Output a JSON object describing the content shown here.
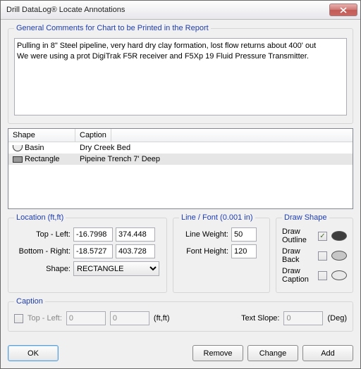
{
  "window": {
    "title": "Drill DataLog® Locate Annotations"
  },
  "comments": {
    "legend": "General Comments for Chart to be Printed in the Report",
    "text": "Pulling in 8\" Steel pipeline, very hard dry clay formation, lost flow returns about 400' out\nWe were using a prot DigiTrak F5R receiver and F5Xp 19 Fluid Pressure Transmitter."
  },
  "table": {
    "head_shape": "Shape",
    "head_caption": "Caption",
    "rows": [
      {
        "shape": "Basin",
        "caption": "Dry Creek Bed"
      },
      {
        "shape": "Rectangle",
        "caption": "Pipeine Trench 7' Deep"
      }
    ]
  },
  "location": {
    "legend": "Location (ft,ft)",
    "top_left_label": "Top - Left:",
    "bottom_right_label": "Bottom - Right:",
    "shape_label": "Shape:",
    "tl_x": "-16.7998",
    "tl_y": "374.448",
    "br_x": "-18.5727",
    "br_y": "403.728",
    "shape_value": "RECTANGLE"
  },
  "linefont": {
    "legend": "Line / Font (0.001 in)",
    "lw_label": "Line Weight:",
    "fh_label": "Font Height:",
    "lw": "50",
    "fh": "120"
  },
  "draw": {
    "legend": "Draw Shape",
    "outline_label": "Draw Outline",
    "back_label": "Draw Back",
    "caption_label": "Draw Caption",
    "outline_checked": "✓"
  },
  "caption": {
    "legend": "Caption",
    "tl_label": "Top - Left:",
    "unit": "(ft,ft)",
    "slope_label": "Text Slope:",
    "slope_unit": "(Deg)",
    "x": "0",
    "y": "0",
    "slope": "0"
  },
  "buttons": {
    "ok": "OK",
    "remove": "Remove",
    "change": "Change",
    "add": "Add"
  }
}
